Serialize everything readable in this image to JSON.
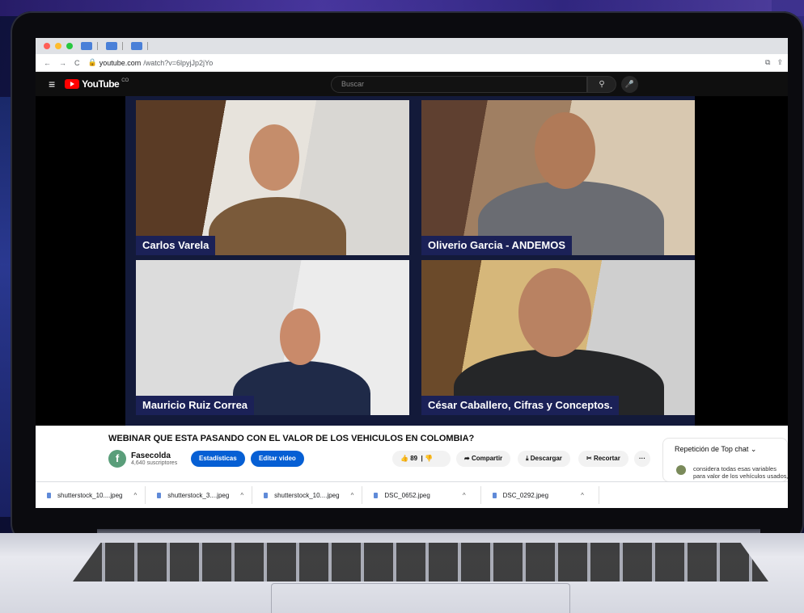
{
  "browser": {
    "url_host": "youtube.com",
    "url_path": "/watch?v=6lpyjJp2jYo"
  },
  "youtube": {
    "logo_text": "YouTube",
    "country_code": "CO",
    "search_placeholder": "Buscar"
  },
  "participants": [
    {
      "name": "Carlos Varela"
    },
    {
      "name": "Oliverio Garcia - ANDEMOS"
    },
    {
      "name": "Mauricio Ruiz Correa"
    },
    {
      "name": "César Caballero, Cifras y Conceptos."
    }
  ],
  "video_info": {
    "title": "WEBINAR QUE ESTA PASANDO CON EL VALOR DE LOS VEHICULOS EN COLOMBIA?",
    "channel_name": "Fasecolda",
    "subscribers": "4,640 suscriptores",
    "stats_button": "Estadísticas",
    "edit_button": "Editar video",
    "likes": "89",
    "share_label": "Compartir",
    "download_label": "Descargar",
    "clip_label": "Recortar",
    "more_label": "···"
  },
  "chat": {
    "header": "Repetición de Top chat",
    "message": "considera todas esas variables para valor de los vehículos usados, porq"
  },
  "downloads": [
    {
      "name": "shutterstock_10....jpeg"
    },
    {
      "name": "shutterstock_3....jpeg"
    },
    {
      "name": "shutterstock_10....jpeg"
    },
    {
      "name": "DSC_0652.jpeg"
    },
    {
      "name": "DSC_0292.jpeg"
    }
  ],
  "colors": {
    "youtube_red": "#ff0000",
    "primary_blue": "#065fd4",
    "name_tag_bg": "#1b2157"
  }
}
